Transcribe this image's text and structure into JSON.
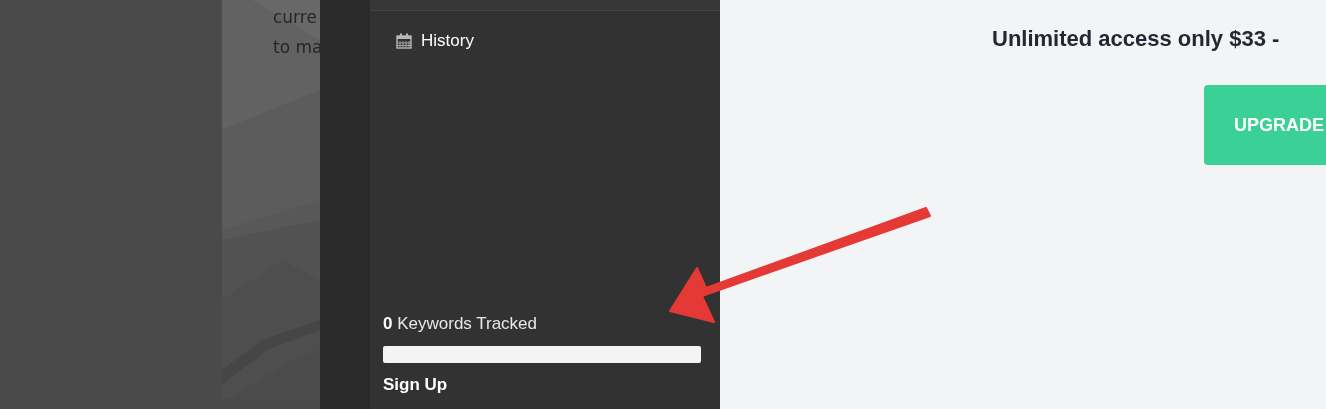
{
  "background_panel": {
    "lines": [
      "curre",
      "to ma"
    ]
  },
  "sidebar": {
    "items": [
      {
        "label": "History"
      }
    ],
    "usage": {
      "text": "**0** Keywords Tracked",
      "level": 0
    },
    "sign_up": "Sign Up"
  },
  "main": {
    "heading": "Unlimited access only $33 -",
    "button": "UPGRADE"
  }
}
